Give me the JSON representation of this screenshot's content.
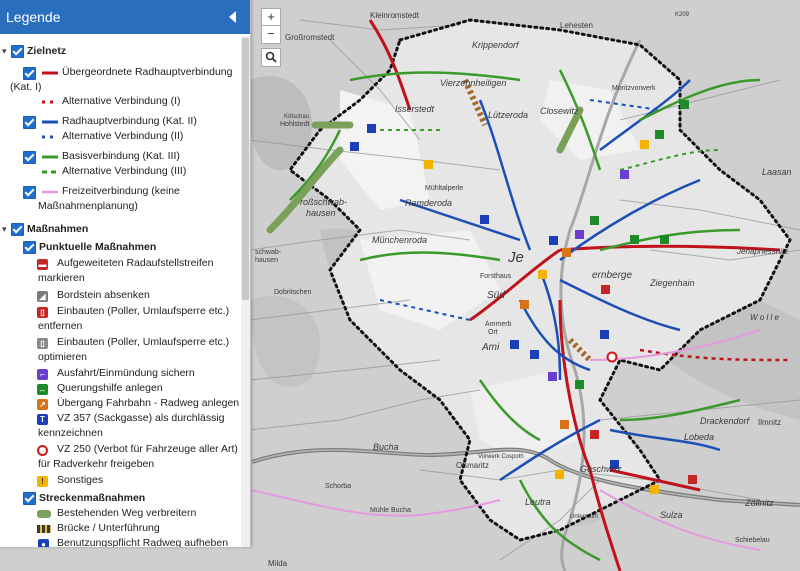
{
  "legend": {
    "title": "Legende",
    "zielnetz": {
      "label": "Zielnetz",
      "items": [
        {
          "label": "Übergeordnete Radhauptverbindung",
          "label2": "(Kat. I)",
          "color": "#c0121b",
          "style": "solid"
        },
        {
          "label": "Alternative Verbindung (I)",
          "color": "#c0121b",
          "style": "dashed"
        },
        {
          "label": "Radhauptverbindung (Kat. II)",
          "color": "#1a4fb5",
          "style": "solid"
        },
        {
          "label": "Alternative Verbindung (II)",
          "color": "#1a4fb5",
          "style": "dashed"
        },
        {
          "label": "Basisverbindung (Kat. III)",
          "color": "#3a9a2a",
          "style": "solid"
        },
        {
          "label": "Alternative Verbindung (III)",
          "color": "#3a9a2a",
          "style": "dashed"
        },
        {
          "label": "Freizeitverbindung (keine",
          "label2": "Maßnahmenplanung)",
          "color": "#e59ae0",
          "style": "solid"
        }
      ]
    },
    "massnahmen": {
      "label": "Maßnahmen",
      "punktuell": {
        "label": "Punktuelle Maßnahmen",
        "items": [
          {
            "label": "Aufgeweiteten Radaufstellstreifen",
            "label2": "markieren",
            "icon": "widened-lane-icon",
            "color": "#c52525"
          },
          {
            "label": "Bordstein absenken",
            "icon": "curb-icon",
            "color": "#7a7a7a"
          },
          {
            "label": "Einbauten (Poller, Umlaufsperre etc.)",
            "label2": "entfernen",
            "icon": "bollard-remove-icon",
            "color": "#c52525"
          },
          {
            "label": "Einbauten (Poller, Umlaufsperre etc.)",
            "label2": "optimieren",
            "icon": "bollard-optimize-icon",
            "color": "#8a8a8a"
          },
          {
            "label": "Ausfahrt/Einmündung sichern",
            "icon": "junction-icon",
            "color": "#6a3fd0"
          },
          {
            "label": "Querungshilfe anlegen",
            "icon": "crossing-icon",
            "color": "#1e8a2a"
          },
          {
            "label": "Übergang Fahrbahn - Radweg anlegen",
            "icon": "transition-icon",
            "color": "#d9731a"
          },
          {
            "label": "VZ 357 (Sackgasse) als durchlässig",
            "label2": "kennzeichnen",
            "icon": "deadend-sign-icon",
            "color": "#1a3fb8"
          },
          {
            "label": "VZ 250 (Verbot für Fahrzeuge aller Art)",
            "label2": "für Radverkehr freigeben",
            "icon": "prohibition-sign-icon",
            "color": "#d21a1a"
          },
          {
            "label": "Sonstiges",
            "icon": "other-icon",
            "color": "#f2b400"
          }
        ]
      },
      "strecken": {
        "label": "Streckenmaßnahmen",
        "items": [
          {
            "label": "Bestehenden Weg verbreitern",
            "icon": "widen-path-icon",
            "color": "#7aa05a"
          },
          {
            "label": "Brücke / Unterführung",
            "icon": "bridge-icon",
            "color": "#3a3a3a"
          },
          {
            "label": "Benutzungspflicht Radweg aufheben",
            "icon": "mandatory-path-icon",
            "color": "#1a3fb8"
          }
        ]
      }
    }
  },
  "map_controls": {
    "zoom_in": "+",
    "zoom_out": "−",
    "search": "search-icon"
  },
  "map_labels": {
    "kleinromstedt": "Kleinromstedt",
    "lehesten": "Lehesten",
    "grossromstedt": "Großromstedt",
    "krippendorf": "Krippendorf",
    "vierzehnheiligen": "Vierzehnheiligen",
    "moritzvorwerk": "Moritzvorwerk",
    "isserstedt": "Isserstedt",
    "luetzeroda": "Lützeroda",
    "closewitz": "Closewitz",
    "koetschau": "Kötschau",
    "hohlstedt": "Hohlstedt",
    "muehltalperle": "Mühltalperle",
    "grossschwabhausen": "roßschwab-",
    "grossschwabhausen2": "hausen",
    "remderoda": "Remderoda",
    "laasan": "Laasan",
    "muenchenroda": "Münchenroda",
    "schwab": "schwab-",
    "hausen": "hausen",
    "jena": "Je",
    "forsthaus": "Forsthaus",
    "sued": "Süd",
    "kernberge": "ernberge",
    "ziegenhain": "Ziegenhain",
    "jenapriessnitz": "Jenapriessnitz",
    "wolle": "W o l l e",
    "dobritschen": "Dobritschen",
    "ammerbach": "Ammerb",
    "orts": "Ort",
    "ami": "Ami",
    "drackendorf": "Drackendorf",
    "lobeda": "Lobeda",
    "ilmnitz": "Ilmnitz",
    "bucha": "Bucha",
    "vorwerk": "Vorwerk Cospoth",
    "ossmaritz": "Oßmaritz",
    "goeschwitz": "Göschwitz",
    "schorba": "Schorba",
    "muehle": "Mühle Bucha",
    "leutra": "Leutra",
    "sulza": "Sulza",
    "zoellnitz": "Zöllnitz",
    "untermuehle": "Untermühl",
    "schiebelau": "Schiebelau",
    "milda": "Milda",
    "k209": "K209"
  }
}
